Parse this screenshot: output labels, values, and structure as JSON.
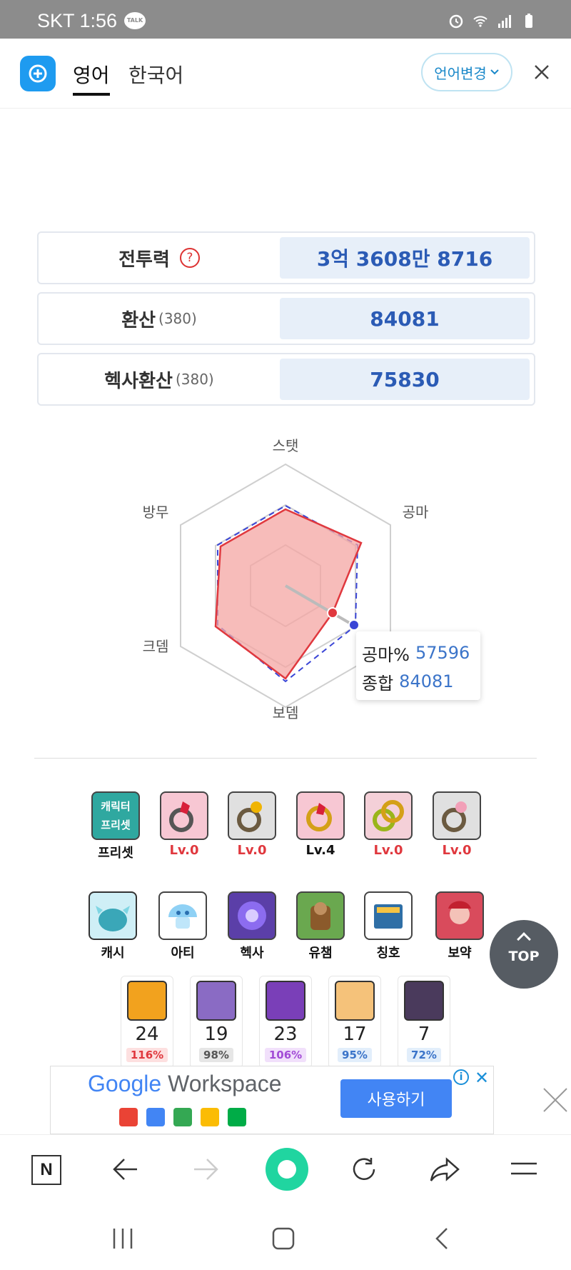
{
  "status": {
    "carrier_time": "SKT 1:56",
    "talk": "TALK"
  },
  "header": {
    "tabs": [
      "영어",
      "한국어"
    ],
    "lang_button": "언어변경"
  },
  "stats": [
    {
      "label": "전투력",
      "sub": "",
      "value": "3억 3608만 8716"
    },
    {
      "label": "환산",
      "sub": "(380)",
      "value": "84081"
    },
    {
      "label": "헥사환산",
      "sub": "(380)",
      "value": "75830"
    }
  ],
  "radar": {
    "axes": [
      "스탯",
      "공마",
      "보뎀",
      "크뎀",
      "방무"
    ],
    "tooltip": {
      "k1": "공마%",
      "v1": "57596",
      "k2": "종합",
      "v2": "84081"
    },
    "colors": {
      "fill": "#f4a5a3",
      "stroke": "#e0383e",
      "dashed": "#3a45d6"
    }
  },
  "equipment": [
    {
      "name": "preset",
      "caption": "프리셋",
      "badge": "캐릭터\n프리셋"
    },
    {
      "name": "ring-1",
      "caption": "Lv.0"
    },
    {
      "name": "ring-2",
      "caption": "Lv.0"
    },
    {
      "name": "ring-3",
      "caption": "Lv.4"
    },
    {
      "name": "ring-4",
      "caption": "Lv.0"
    },
    {
      "name": "ring-5",
      "caption": "Lv.0"
    }
  ],
  "categories": [
    "캐시",
    "아티",
    "헥사",
    "유챔",
    "칭호",
    "보약"
  ],
  "cores": [
    {
      "level": "24",
      "pct": "116%"
    },
    {
      "level": "19",
      "pct": "98%"
    },
    {
      "level": "23",
      "pct": "106%"
    },
    {
      "level": "17",
      "pct": "95%"
    },
    {
      "level": "7",
      "pct": "72%"
    }
  ],
  "top_button": "TOP",
  "ad": {
    "brand_google": "Google",
    "brand_workspace": "Workspace",
    "cta": "사용하기",
    "info": "i"
  },
  "browser": {
    "n": "N"
  }
}
